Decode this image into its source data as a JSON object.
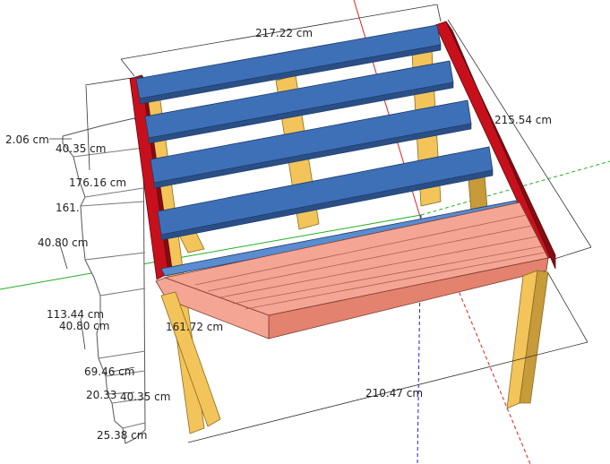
{
  "colors": {
    "background": "#ffffff",
    "rail_red": "#c8101c",
    "rail_red_dark": "#8a0a12",
    "joist_blue": "#3e70b8",
    "joist_blue_dark": "#2a4f86",
    "joist_blue_light": "#5a8cd0",
    "post_yellow": "#f2c45a",
    "post_yellow_dark": "#c79a3a",
    "deck_pink": "#f4a594",
    "deck_pink_dark": "#e3826e",
    "axis_red": "#e02020",
    "axis_green": "#20b020",
    "axis_blue": "#2020e0",
    "dim_line": "#333333"
  },
  "dimensions": {
    "top_width": "217.22 cm",
    "right_depth": "215.54 cm",
    "bottom_width": "210.47 cm",
    "front_partial": "161.72 cm",
    "stair_1": "2.06 cm",
    "stair_2": "40.35 cm",
    "stair_3": "176.16 cm",
    "stair_4": "161.",
    "stair_5": "40.80 cm",
    "stair_6": "113.44 cm",
    "stair_7": "40.80 cm",
    "stair_8": "69.46 cm",
    "stair_9": "20.33",
    "stair_10": "40.35 cm",
    "stair_11": "25.38 cm"
  },
  "icons": {
    "origin_axes": "axes-icon"
  }
}
